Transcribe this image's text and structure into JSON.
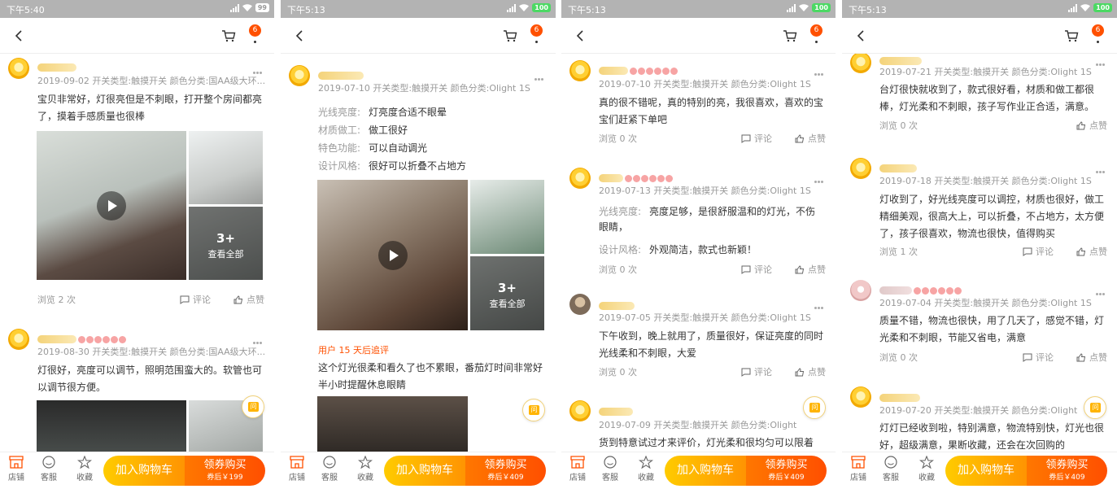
{
  "colors": {
    "accent": "#ff5000",
    "cart_button": "#ffa200",
    "buy_button": "#ff5000",
    "status_bar": "#b3b3b3"
  },
  "common": {
    "cart_badge": "6",
    "bottom": {
      "shop": "店铺",
      "service": "客服",
      "favorite": "收藏",
      "add_cart": "加入购物车",
      "coupon_buy": "领券购买"
    },
    "views_label_0": "浏览 0 次",
    "comment": "评论",
    "like": "点赞",
    "ask": "问"
  },
  "panels": [
    {
      "time": "下午5:40",
      "battery": "99",
      "coupon_price": "券后￥199",
      "reviews": [
        {
          "meta": "2019-09-02 开关类型:触摸开关 颜色分类:国AA级大环...",
          "text": "宝贝非常好，灯很亮但是不刺眼，打开整个房间都亮了，摸着手感质量也很棒",
          "views": "浏览 2 次",
          "more_count": "3+",
          "more_label": "查看全部"
        },
        {
          "meta": "2019-08-30 开关类型:触摸开关 颜色分类:国AA级大环...",
          "text": "灯很好，亮度可以调节，照明范围蛮大的。软管也可以调节很方便。"
        }
      ]
    },
    {
      "time": "下午5:13",
      "battery": "100",
      "coupon_price": "券后￥409",
      "reviews": [
        {
          "meta": "2019-07-10 开关类型:触摸开关 颜色分类:Olight 1S",
          "attrs": [
            {
              "k": "光线亮度:",
              "v": "灯亮度合适不眼晕"
            },
            {
              "k": "材质做工:",
              "v": "做工很好"
            },
            {
              "k": "特色功能:",
              "v": "可以自动调光"
            },
            {
              "k": "设计风格:",
              "v": "很好可以折叠不占地方"
            }
          ],
          "more_count": "3+",
          "more_label": "查看全部",
          "append_label": "用户 15 天后追评",
          "append_text": "这个灯光很柔和看久了也不累眼，番茄灯时间非常好半小时提醒休息眼睛"
        }
      ]
    },
    {
      "time": "下午5:13",
      "battery": "100",
      "coupon_price": "券后￥409",
      "reviews": [
        {
          "meta": "2019-07-10 开关类型:触摸开关 颜色分类:Olight 1S",
          "text": "真的很不错呢，真的特别的亮，我很喜欢，喜欢的宝宝们赶紧下单吧"
        },
        {
          "meta": "2019-07-13 开关类型:触摸开关 颜色分类:Olight 1S",
          "attrs": [
            {
              "k": "光线亮度:",
              "v": "亮度足够，是很舒服温和的灯光，不伤眼睛，"
            },
            {
              "k": "设计风格:",
              "v": "外观简洁，款式也新颖！"
            }
          ]
        },
        {
          "meta": "2019-07-05 开关类型:触摸开关 颜色分类:Olight 1S",
          "text": "下午收到，晚上就用了，质量很好，保证亮度的同时光线柔和不刺眼，大爱"
        },
        {
          "meta": "2019-07-09 开关类型:触摸开关 颜色分类:Olight 1S",
          "text": "货到特意试过才来评价，灯光柔和很均匀可以限着"
        }
      ]
    },
    {
      "time": "下午5:13",
      "battery": "100",
      "coupon_price": "券后￥409",
      "reviews": [
        {
          "meta": "2019-07-21 开关类型:触摸开关 颜色分类:Olight 1S",
          "text": "台灯很快就收到了，款式很好看，材质和做工都很棒，灯光柔和不刺眼，孩子写作业正合适，满意。",
          "views": "浏览 0 次"
        },
        {
          "meta": "2019-07-18 开关类型:触摸开关 颜色分类:Olight 1S",
          "text": "灯收到了，好光线亮度可以调控，材质也很好，做工精细美观，很高大上，可以折叠，不占地方，太方便了，孩子很喜欢，物流也很快，值得购买",
          "views": "浏览 1 次"
        },
        {
          "meta": "2019-07-04 开关类型:触摸开关 颜色分类:Olight 1S",
          "text": "质量不错，物流也很快，用了几天了，感觉不错，灯光柔和不刺眼，节能又省电，满意",
          "views": "浏览 0 次"
        },
        {
          "meta": "2019-07-20 开关类型:触摸开关 颜色分类:Olight 1S",
          "text": "灯灯已经收到啦，特别满意，物流特别快，灯光也很好，超级满意，果断收藏，还会在次回购的"
        }
      ]
    }
  ]
}
